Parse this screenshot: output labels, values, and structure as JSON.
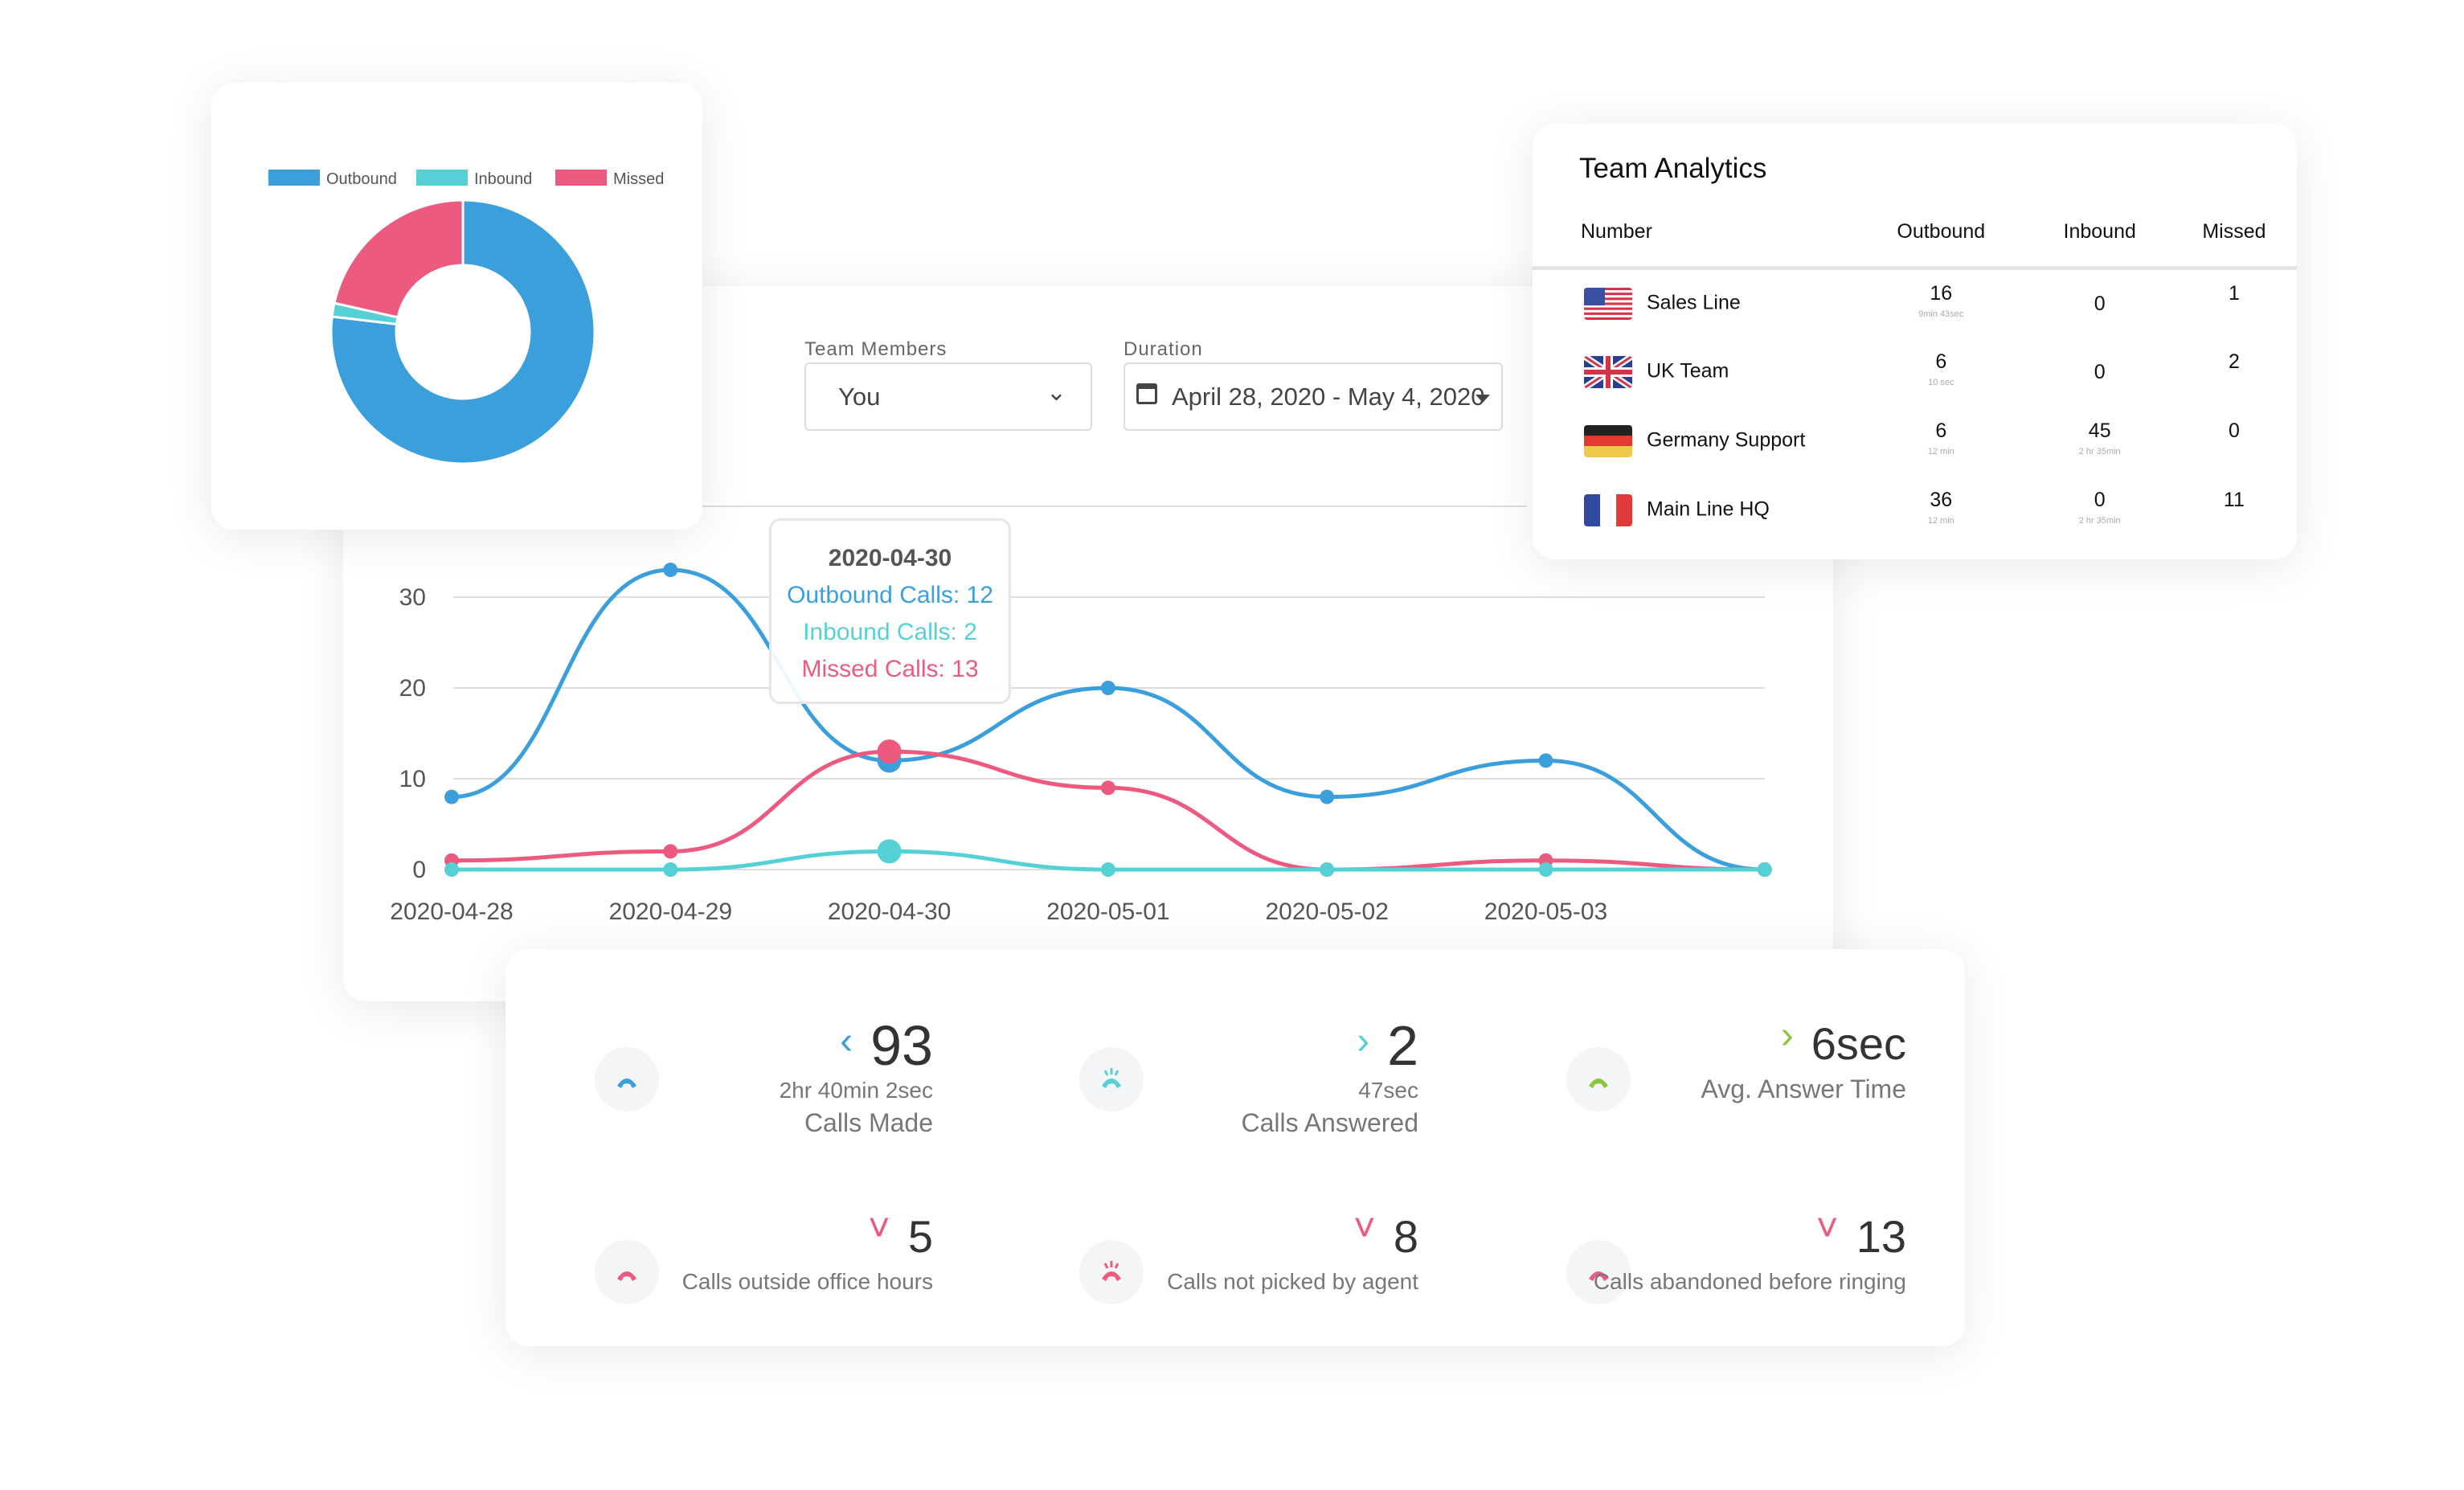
{
  "filters": {
    "team_members_label": "Team Members",
    "team_members_value": "You",
    "duration_label": "Duration",
    "duration_value": "April 28, 2020 - May 4, 2020"
  },
  "colors": {
    "outbound": "#3b9fdc",
    "inbound": "#55d1d6",
    "missed": "#ec5b7f",
    "answer_time": "#8cc63f"
  },
  "tooltip": {
    "date": "2020-04-30",
    "outbound": "Outbound Calls: 12",
    "inbound": "Inbound Calls: 2",
    "missed": "Missed Calls: 13"
  },
  "chart_data": [
    {
      "type": "line",
      "categories": [
        "2020-04-28",
        "2020-04-29",
        "2020-04-30",
        "2020-05-01",
        "2020-05-02",
        "2020-05-03",
        ""
      ],
      "yticks": [
        0,
        10,
        20,
        30
      ],
      "ylim": [
        0,
        33
      ],
      "grid": true,
      "series": [
        {
          "key": "outbound",
          "values": [
            8,
            33,
            12,
            20,
            8,
            12,
            0
          ]
        },
        {
          "key": "missed",
          "values": [
            1,
            2,
            13,
            9,
            0,
            1,
            0
          ]
        },
        {
          "key": "inbound",
          "values": [
            0,
            0,
            2,
            0,
            0,
            0,
            0
          ]
        }
      ]
    },
    {
      "type": "pie",
      "donut": true,
      "legend": [
        "Outbound",
        "Inbound",
        "Missed"
      ],
      "legend_placement": "top",
      "values": [
        93,
        2,
        26
      ]
    }
  ],
  "team": {
    "title": "Team Analytics",
    "headers": [
      "Number",
      "Outbound",
      "Inbound",
      "Missed"
    ],
    "rows": [
      {
        "flag": "us-flag-icon",
        "name": "Sales Line",
        "outbound": "16",
        "outbound_sub": "9min 43sec",
        "inbound": "0",
        "inbound_sub": "",
        "missed": "1"
      },
      {
        "flag": "uk-flag-icon",
        "name": "UK Team",
        "outbound": "6",
        "outbound_sub": "10 sec",
        "inbound": "0",
        "inbound_sub": "",
        "missed": "2"
      },
      {
        "flag": "germany-flag-icon",
        "name": "Germany Support",
        "outbound": "6",
        "outbound_sub": "12 min",
        "inbound": "45",
        "inbound_sub": "2 hr 35min",
        "missed": "0"
      },
      {
        "flag": "france-flag-icon",
        "name": "Main Line HQ",
        "outbound": "36",
        "outbound_sub": "12 min",
        "inbound": "0",
        "inbound_sub": "2 hr 35min",
        "missed": "11"
      }
    ]
  },
  "stats": [
    {
      "icon": "outgoing-call-icon",
      "arrow": "‹",
      "value": "93",
      "sub": "2hr 40min 2sec",
      "label": "Calls Made",
      "color": "#3b9fdc"
    },
    {
      "icon": "answered-call-icon",
      "arrow": "›",
      "value": "2",
      "sub": "47sec",
      "label": "Calls Answered",
      "color": "#55d1d6"
    },
    {
      "icon": "ringing-phone-icon",
      "arrow": "›",
      "value": "6sec",
      "sub": "",
      "label": "Avg. Answer Time",
      "color": "#8cc63f"
    },
    {
      "icon": "missed-call-icon",
      "arrow": "˅",
      "value": "5",
      "sub": "",
      "label": "Calls outside office hours",
      "color": "#ec5b7f"
    },
    {
      "icon": "unanswered-call-icon",
      "arrow": "˅",
      "value": "8",
      "sub": "",
      "label": "Calls not picked by agent",
      "color": "#ec5b7f"
    },
    {
      "icon": "hangup-icon",
      "arrow": "˅",
      "value": "13",
      "sub": "",
      "label": "Calls abandoned before ringing",
      "color": "#ec5b7f"
    }
  ]
}
